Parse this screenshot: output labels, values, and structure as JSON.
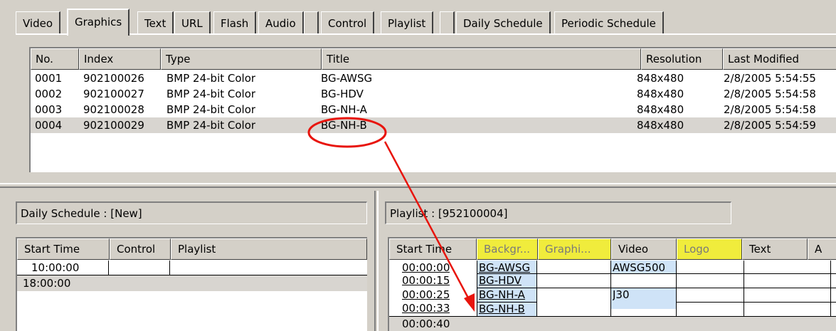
{
  "tabs": [
    "Video",
    "Graphics",
    "Text",
    "URL",
    "Flash",
    "Audio",
    "Control",
    "Playlist",
    "Daily Schedule",
    "Periodic Schedule"
  ],
  "media_table": {
    "columns": [
      "No.",
      "Index",
      "Type",
      "Title",
      "Resolution",
      "Last Modified"
    ],
    "rows": [
      [
        "0001",
        "902100026",
        "BMP 24-bit Color",
        "BG-AWSG",
        "848x480",
        "2/8/2005 5:54:55"
      ],
      [
        "0002",
        "902100027",
        "BMP 24-bit Color",
        "BG-HDV",
        "848x480",
        "2/8/2005 5:54:58"
      ],
      [
        "0003",
        "902100028",
        "BMP 24-bit Color",
        "BG-NH-A",
        "848x480",
        "2/8/2005 5:54:58"
      ],
      [
        "0004",
        "902100029",
        "BMP 24-bit Color",
        "BG-NH-B",
        "848x480",
        "2/8/2005 5:54:59"
      ]
    ],
    "selected_row": 4
  },
  "daily_schedule": {
    "caption": "Daily Schedule : [New]",
    "columns": [
      "Start Time",
      "Control",
      "Playlist"
    ],
    "rows": [
      [
        "10:00:00",
        "",
        ""
      ],
      [
        "18:00:00",
        "",
        ""
      ]
    ]
  },
  "playlist": {
    "caption": "Playlist : [952100004]",
    "columns": [
      "Start Time",
      "Backgr...",
      "Graphi...",
      "Video",
      "Logo",
      "Text",
      "A"
    ],
    "highlight_color": "#f0ec3c",
    "cell_color": "#cfe3f7",
    "rows": [
      [
        "00:00:00",
        "BG-AWSG",
        "",
        "AWSG500"
      ],
      [
        "00:00:15",
        "BG-HDV",
        "",
        ""
      ],
      [
        "00:00:25",
        "BG-NH-A",
        "",
        "J30"
      ],
      [
        "00:00:33",
        "BG-NH-B",
        "",
        ""
      ],
      [
        "00:00:40",
        "",
        "",
        ""
      ]
    ]
  },
  "annotation": {
    "color": "#e8140c"
  }
}
